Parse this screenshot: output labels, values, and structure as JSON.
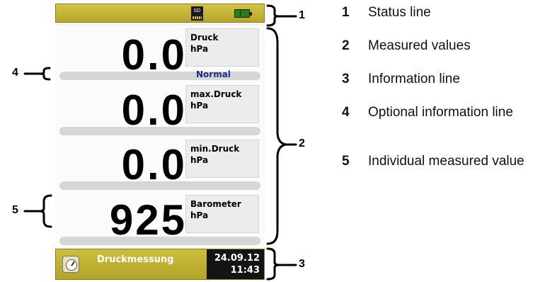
{
  "status_bar": {
    "sd_label": "SD"
  },
  "tiles": [
    {
      "value": "0.0",
      "label": "Druck",
      "unit": "hPa"
    },
    {
      "value": "0.0",
      "label": "max.Druck",
      "unit": "hPa"
    },
    {
      "value": "0.0",
      "label": "min.Druck",
      "unit": "hPa"
    },
    {
      "value": "925",
      "label": "Barometer",
      "unit": "hPa"
    }
  ],
  "optional_info": "Normal",
  "info_bar": {
    "title": "Druckmessung",
    "date": "24.09.12",
    "time": "11:43"
  },
  "callouts": [
    "1",
    "2",
    "3",
    "4",
    "5"
  ],
  "legend": [
    {
      "num": "1",
      "text": "Status line"
    },
    {
      "num": "2",
      "text": "Measured values"
    },
    {
      "num": "3",
      "text": "Information line"
    },
    {
      "num": "4",
      "text": "Optional information line"
    },
    {
      "num": "5",
      "text": "Individual measured value"
    }
  ],
  "colors": {
    "status_bar": "#c8b83a",
    "info_bar": "#b8a92e",
    "datetime_bg": "#141414",
    "optional_info_text": "#1a2a8a"
  }
}
